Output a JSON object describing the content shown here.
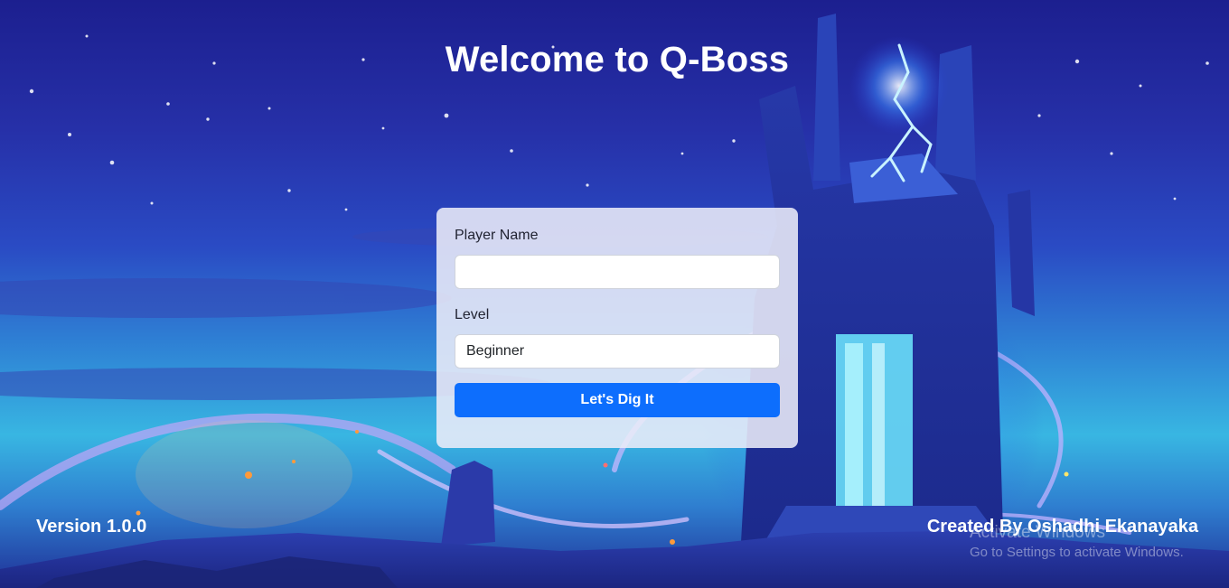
{
  "header": {
    "title": "Welcome to Q-Boss"
  },
  "form": {
    "player_name_label": "Player Name",
    "player_name_value": "",
    "level_label": "Level",
    "level_value": "Beginner",
    "submit_label": "Let's Dig It"
  },
  "footer": {
    "version": "Version 1.0.0",
    "credit": "Created By Oshadhi Ekanayaka"
  },
  "watermark": {
    "line1": "Activate Windows",
    "line2": "Go to Settings to activate Windows."
  },
  "colors": {
    "primary_button": "#0d6efd",
    "sky_top": "#1c1f8f",
    "glow": "#38b6e2"
  }
}
